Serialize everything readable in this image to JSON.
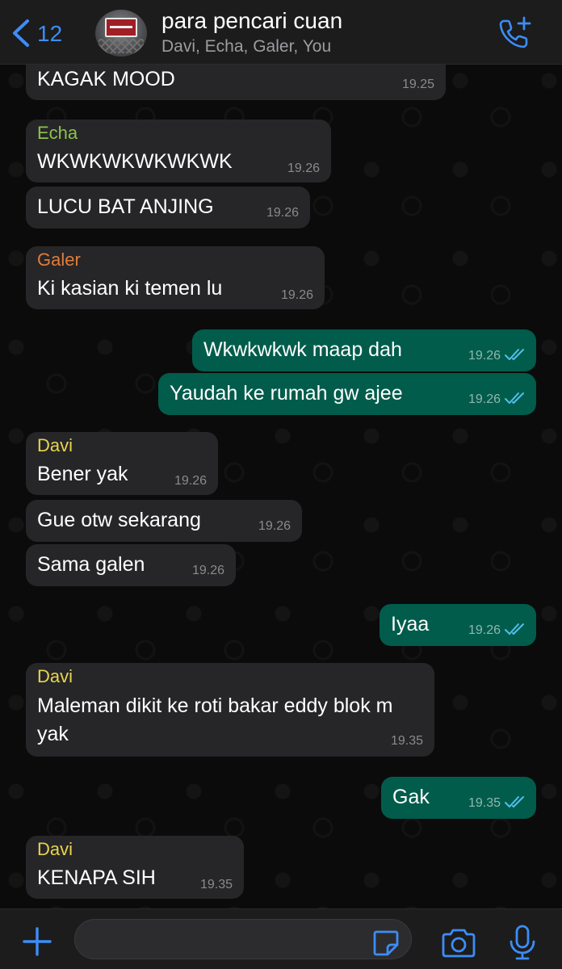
{
  "header": {
    "back_count": "12",
    "title": "para pencari cuan",
    "subtitle": "Davi, Echa, Galer, You",
    "icons": [
      "chevron-left-icon",
      "group-avatar",
      "add-call-icon"
    ]
  },
  "colors": {
    "accent": "#3d8df5",
    "incoming_bubble": "#262628",
    "outgoing_bubble": "#015c4b",
    "echa": "#8bc34a",
    "galer": "#e07c3a",
    "davi": "#e8d44d",
    "read_ticks": "#53bdeb"
  },
  "messages": [
    {
      "text": "KAGAK MOOD",
      "time": "19.25"
    },
    {
      "sender": "Echa",
      "text": "WKWKWKWKWKWK",
      "time": "19.26"
    },
    {
      "text": "LUCU BAT ANJING",
      "time": "19.26"
    },
    {
      "sender": "Galer",
      "text": "Ki kasian ki temen lu",
      "time": "19.26"
    },
    {
      "text": "Wkwkwkwk maap dah",
      "time": "19.26",
      "status": "read"
    },
    {
      "text": "Yaudah ke rumah gw ajee",
      "time": "19.26",
      "status": "read"
    },
    {
      "sender": "Davi",
      "text": "Bener yak",
      "time": "19.26"
    },
    {
      "text": "Gue otw sekarang",
      "time": "19.26"
    },
    {
      "text": "Sama galen",
      "time": "19.26"
    },
    {
      "text": "Iyaa",
      "time": "19.26",
      "status": "read"
    },
    {
      "sender": "Davi",
      "text": "Maleman dikit ke roti bakar eddy blok m yak",
      "time": "19.35"
    },
    {
      "text": "Gak",
      "time": "19.35",
      "status": "read"
    },
    {
      "sender": "Davi",
      "text": "KENAPA SIH",
      "time": "19.35"
    }
  ],
  "composer": {
    "placeholder": "",
    "icons": [
      "plus-icon",
      "sticker-icon",
      "camera-icon",
      "microphone-icon"
    ]
  }
}
